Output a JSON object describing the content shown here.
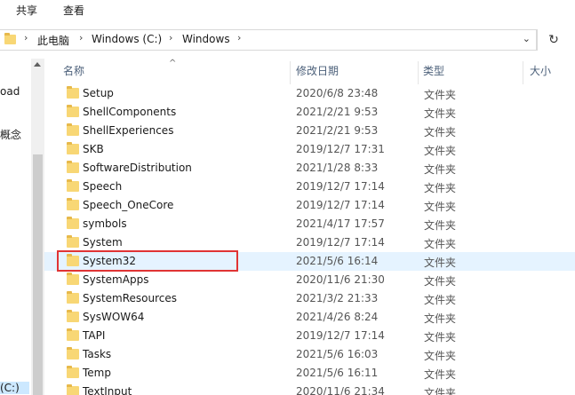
{
  "ribbon": {
    "tabs": [
      "共享",
      "查看"
    ]
  },
  "address_bar": {
    "segments": [
      "此电脑",
      "Windows (C:)",
      "Windows"
    ],
    "dropdown_icon": "chevron-down-icon",
    "refresh_icon": "refresh-icon"
  },
  "nav_pane": {
    "items": [
      "oad",
      "概念",
      "(C:)"
    ]
  },
  "columns": {
    "name": "名称",
    "date": "修改日期",
    "type": "类型",
    "size": "大小"
  },
  "rows": [
    {
      "name": "Setup",
      "date": "2020/6/8 23:48",
      "type": "文件夹"
    },
    {
      "name": "ShellComponents",
      "date": "2021/2/21 9:53",
      "type": "文件夹"
    },
    {
      "name": "ShellExperiences",
      "date": "2021/2/21 9:53",
      "type": "文件夹"
    },
    {
      "name": "SKB",
      "date": "2019/12/7 17:31",
      "type": "文件夹"
    },
    {
      "name": "SoftwareDistribution",
      "date": "2021/1/28 8:33",
      "type": "文件夹"
    },
    {
      "name": "Speech",
      "date": "2019/12/7 17:14",
      "type": "文件夹"
    },
    {
      "name": "Speech_OneCore",
      "date": "2019/12/7 17:14",
      "type": "文件夹"
    },
    {
      "name": "symbols",
      "date": "2021/4/17 17:57",
      "type": "文件夹"
    },
    {
      "name": "System",
      "date": "2019/12/7 17:14",
      "type": "文件夹"
    },
    {
      "name": "System32",
      "date": "2021/5/6 16:14",
      "type": "文件夹"
    },
    {
      "name": "SystemApps",
      "date": "2020/11/6 21:30",
      "type": "文件夹"
    },
    {
      "name": "SystemResources",
      "date": "2021/3/2 21:33",
      "type": "文件夹"
    },
    {
      "name": "SysWOW64",
      "date": "2021/4/26 8:24",
      "type": "文件夹"
    },
    {
      "name": "TAPI",
      "date": "2019/12/7 17:14",
      "type": "文件夹"
    },
    {
      "name": "Tasks",
      "date": "2021/5/6 16:03",
      "type": "文件夹"
    },
    {
      "name": "Temp",
      "date": "2021/5/6 16:11",
      "type": "文件夹"
    },
    {
      "name": "TextInput",
      "date": "2020/11/6 21:34",
      "type": "文件夹"
    }
  ],
  "selected_row": "System32",
  "colors": {
    "selection": "#e5f3ff",
    "highlight_box": "#e03434",
    "folder": "#f8d775"
  }
}
